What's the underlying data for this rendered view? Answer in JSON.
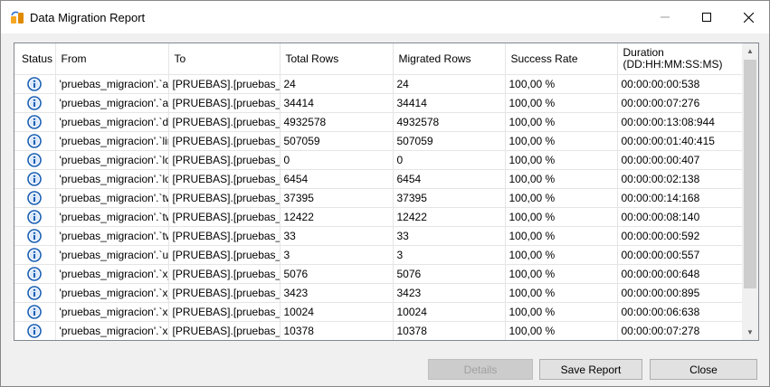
{
  "window": {
    "title": "Data Migration Report"
  },
  "columns": {
    "status": "Status",
    "from": "From",
    "to": "To",
    "total_rows": "Total Rows",
    "migrated_rows": "Migrated Rows",
    "success_rate": "Success Rate",
    "duration_line1": "Duration",
    "duration_line2": "(DD:HH:MM:SS:MS)"
  },
  "rows": [
    {
      "from": "'pruebas_migracion'.`acco",
      "to": "[PRUEBAS].[pruebas_mig",
      "total": "24",
      "migrated": "24",
      "rate": "100,00 %",
      "duration": "00:00:00:00:538"
    },
    {
      "from": "'pruebas_migracion'.`acco",
      "to": "[PRUEBAS].[pruebas_mig",
      "total": "34414",
      "migrated": "34414",
      "rate": "100,00 %",
      "duration": "00:00:00:07:276"
    },
    {
      "from": "'pruebas_migracion'.`dev_",
      "to": "[PRUEBAS].[pruebas_mig",
      "total": "4932578",
      "migrated": "4932578",
      "rate": "100,00 %",
      "duration": "00:00:00:13:08:944"
    },
    {
      "from": "'pruebas_migracion'.`linux",
      "to": "[PRUEBAS].[pruebas_mig",
      "total": "507059",
      "migrated": "507059",
      "rate": "100,00 %",
      "duration": "00:00:00:01:40:415"
    },
    {
      "from": "'pruebas_migracion'.`logs",
      "to": "[PRUEBAS].[pruebas_mig",
      "total": "0",
      "migrated": "0",
      "rate": "100,00 %",
      "duration": "00:00:00:00:407"
    },
    {
      "from": "'pruebas_migracion'.`logs",
      "to": "[PRUEBAS].[pruebas_mig",
      "total": "6454",
      "migrated": "6454",
      "rate": "100,00 %",
      "duration": "00:00:00:02:138"
    },
    {
      "from": "'pruebas_migracion'.`tw_f",
      "to": "[PRUEBAS].[pruebas_mig",
      "total": "37395",
      "migrated": "37395",
      "rate": "100,00 %",
      "duration": "00:00:00:14:168"
    },
    {
      "from": "'pruebas_migracion'.`tw_u",
      "to": "[PRUEBAS].[pruebas_mig",
      "total": "12422",
      "migrated": "12422",
      "rate": "100,00 %",
      "duration": "00:00:00:08:140"
    },
    {
      "from": "'pruebas_migracion'.`tw_u",
      "to": "[PRUEBAS].[pruebas_mig",
      "total": "33",
      "migrated": "33",
      "rate": "100,00 %",
      "duration": "00:00:00:00:592"
    },
    {
      "from": "'pruebas_migracion'.`user",
      "to": "[PRUEBAS].[pruebas_mig",
      "total": "3",
      "migrated": "3",
      "rate": "100,00 %",
      "duration": "00:00:00:00:557"
    },
    {
      "from": "'pruebas_migracion'.`x_tm",
      "to": "[PRUEBAS].[pruebas_mig",
      "total": "5076",
      "migrated": "5076",
      "rate": "100,00 %",
      "duration": "00:00:00:00:648"
    },
    {
      "from": "'pruebas_migracion'.`x_tm",
      "to": "[PRUEBAS].[pruebas_mig",
      "total": "3423",
      "migrated": "3423",
      "rate": "100,00 %",
      "duration": "00:00:00:00:895"
    },
    {
      "from": "'pruebas_migracion'.`xold",
      "to": "[PRUEBAS].[pruebas_mig",
      "total": "10024",
      "migrated": "10024",
      "rate": "100,00 %",
      "duration": "00:00:00:06:638"
    },
    {
      "from": "'pruebas_migracion'.`xold",
      "to": "[PRUEBAS].[pruebas_mig",
      "total": "10378",
      "migrated": "10378",
      "rate": "100,00 %",
      "duration": "00:00:00:07:278"
    }
  ],
  "buttons": {
    "details": "Details",
    "save_report": "Save Report",
    "close": "Close"
  },
  "icons": {
    "app": "database-migration-icon",
    "status": "info-icon"
  },
  "colors": {
    "info_icon": "#1a5fb4",
    "disabled_text": "#a0a0a0"
  }
}
